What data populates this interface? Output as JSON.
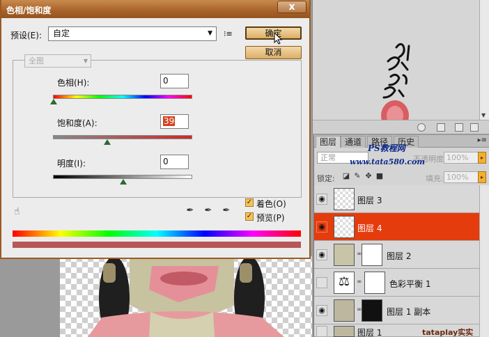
{
  "dialog": {
    "title": "色相/饱和度",
    "close_label": "x",
    "preset_label": "预设(E):",
    "preset_value": "自定",
    "ok_label": "确定",
    "cancel_label": "取消",
    "edit_value": "全图",
    "hue": {
      "label": "色相(H):",
      "value": "0"
    },
    "saturation": {
      "label": "饱和度(A):",
      "value": "39"
    },
    "lightness": {
      "label": "明度(I):",
      "value": "0"
    },
    "colorize": {
      "label": "着色(O)",
      "checked": true
    },
    "preview": {
      "label": "预览(P)",
      "checked": true
    }
  },
  "layers_panel": {
    "tabs": [
      "图层",
      "通道",
      "路径",
      "历史"
    ],
    "blend_mode": "正常",
    "opacity_label": "不透明度:",
    "opacity_value": "100%",
    "lock_label": "锁定:",
    "fill_label": "填充:",
    "fill_value": "100%",
    "layers": [
      {
        "name": "图层 3",
        "visible": true,
        "selected": false
      },
      {
        "name": "图层 4",
        "visible": true,
        "selected": true
      },
      {
        "name": "图层 2",
        "visible": true,
        "selected": false
      },
      {
        "name": "色彩平衡 1",
        "visible": false,
        "selected": false
      },
      {
        "name": "图层 1 副本",
        "visible": true,
        "selected": false
      },
      {
        "name": "图层 1",
        "visible": false,
        "selected": false
      }
    ]
  },
  "watermark": {
    "site_name": "PS教程网",
    "site_url": "www.tata580.com",
    "credit": "tataplay实实"
  },
  "colors": {
    "accent": "#e53c0e",
    "title_bar": "#a8622a",
    "button": "#dcae66"
  }
}
